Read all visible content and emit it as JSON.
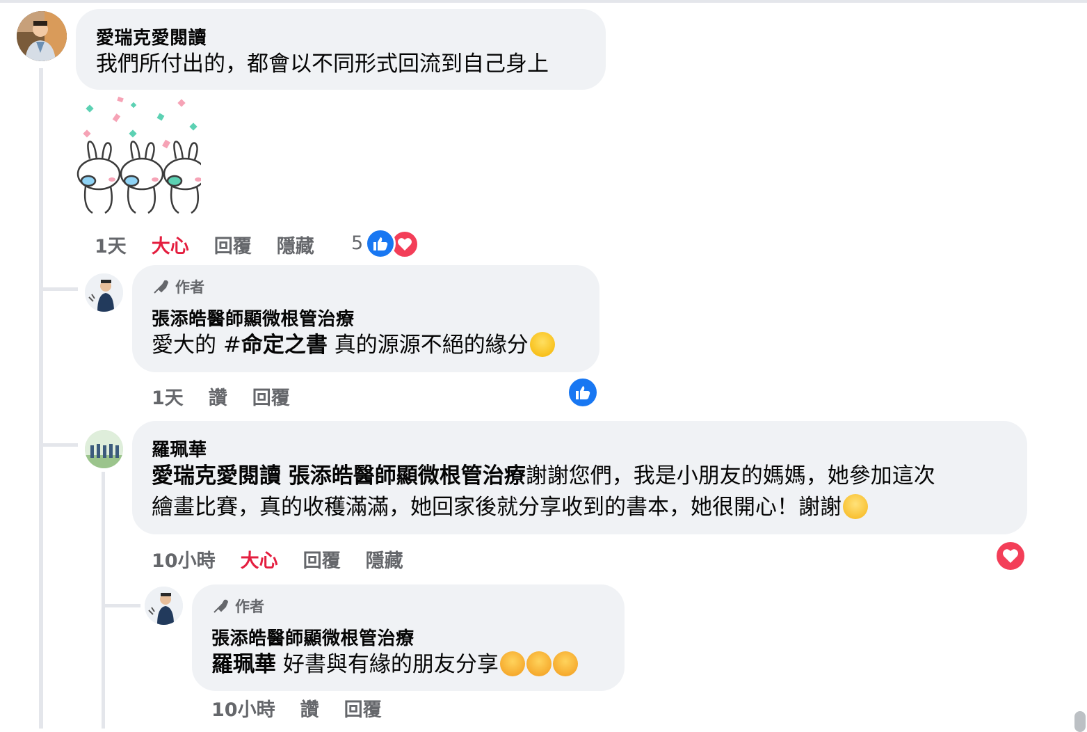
{
  "comments": [
    {
      "name": "愛瑞克愛閱讀",
      "text": "我們所付出的，都會以不同形式回流到自己身上",
      "sticker": "dancing-bunnies-sticker",
      "time": "1天",
      "reaction_label": "大心",
      "reply_label": "回覆",
      "hide_label": "隱藏",
      "reaction_count": "5"
    },
    {
      "author_badge": "作者",
      "name": "張添皓醫師顯微根管治療",
      "text_prefix": "愛大的 #",
      "text_bold": "命定之書",
      "text_suffix": " 真的源源不絕的緣分",
      "time": "1天",
      "like_label": "讚",
      "reply_label": "回覆"
    },
    {
      "name": "羅珮華",
      "mention": "愛瑞克愛閱讀 張添皓醫師顯微根管治療",
      "text_line1": "謝謝您們，我是小朋友的媽媽，她參加這次",
      "text_line2": "繪畫比賽，真的收穫滿滿，她回家後就分享收到的書本，她很開心！謝謝",
      "time": "10小時",
      "reaction_label": "大心",
      "reply_label": "回覆",
      "hide_label": "隱藏"
    },
    {
      "author_badge": "作者",
      "name": "張添皓醫師顯微根管治療",
      "mention": "羅珮華",
      "text": " 好書與有緣的朋友分享",
      "time": "10小時",
      "like_label": "讚",
      "reply_label": "回覆"
    }
  ],
  "colors": {
    "bubble": "#f0f2f5",
    "meta": "#65676b",
    "love": "#e41e3f",
    "like_blue": "#1877f2"
  }
}
